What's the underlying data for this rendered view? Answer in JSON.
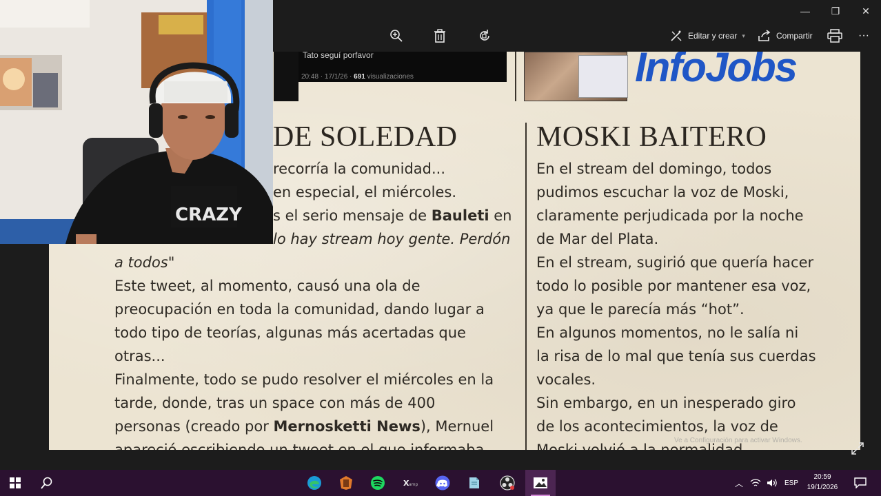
{
  "window": {
    "minimize_label": "—",
    "maximize_label": "❐",
    "close_label": "✕"
  },
  "toolbar": {
    "edit_create_label": "Editar y crear",
    "share_label": "Compartir",
    "more_label": "···",
    "icons": [
      "zoom-in-icon",
      "delete-icon",
      "rotate-icon",
      "edit-icon",
      "share-icon",
      "print-icon",
      "more-icon"
    ]
  },
  "document": {
    "tweet_text": "Tato seguí porfavor",
    "tweet_time": "20:48 · 17/1/26 · ",
    "tweet_views_count": "691",
    "tweet_views_label": " visualizaciones",
    "logo": "InfoJobs",
    "left_headline": "DE SOLEDAD",
    "right_headline": "MOSKI BAITERO",
    "left_lines": [
      {
        "before": "recorría la comunidad...",
        "bold": "",
        "after": "",
        "italic": ""
      },
      {
        "before": "en especial, el miércoles.",
        "bold": "",
        "after": "",
        "italic": ""
      },
      {
        "before": "s el serio mensaje de ",
        "bold": "Bauleti",
        "after": " en",
        "italic": ""
      },
      {
        "before": "",
        "bold": "",
        "after": "",
        "italic": "lo hay stream hoy gente. Perdón"
      }
    ],
    "left_body": [
      {
        "italic": "a todos\""
      },
      {
        "text": "Este tweet, al momento, causó una ola de"
      },
      {
        "text": "preocupación en toda la comunidad, dando lugar a"
      },
      {
        "text": "todo tipo de teorías, algunas más acertadas que"
      },
      {
        "text": "otras..."
      },
      {
        "text": "Finalmente, todo se pudo resolver el miércoles en la"
      },
      {
        "text": "tarde, donde, tras un space con más de 400"
      },
      {
        "before": "personas (creado por ",
        "bold": "Mernosketti News",
        "after": "), Mernuel"
      },
      {
        "text": "apareció escribiendo un tweet en el que informaba"
      }
    ],
    "right_body": [
      "En el stream del domingo, todos",
      "pudimos escuchar la voz de Moski,",
      "claramente perjudicada por la noche",
      "de Mar del Plata.",
      "En el stream, sugirió que quería hacer",
      "todo lo posible por mantener esa voz,",
      "ya que le parecía más “hot”.",
      "En algunos momentos, no le salía ni",
      "la risa de lo mal que tenía sus cuerdas",
      "vocales.",
      "Sin embargo, en un inesperado giro",
      "de los acontecimientos, la voz de",
      "Moski volvió a la normalidad"
    ],
    "watermark": "Ve a Configuración para activar Windows."
  },
  "webcam": {
    "shirt_text": "CRAZY"
  },
  "taskbar": {
    "apps": [
      "windows-start-icon",
      "search-icon",
      "edge-icon",
      "files-icon",
      "spotify-icon",
      "xampp-icon",
      "discord-icon",
      "notes-icon",
      "obs-icon",
      "photos-icon"
    ],
    "tray": {
      "language": "ESP",
      "time": "20:59",
      "date": "19/1/2026"
    }
  },
  "colors": {
    "accent": "#1f56c6",
    "paper": "#ece4d2",
    "taskbar": "#2b1130"
  }
}
